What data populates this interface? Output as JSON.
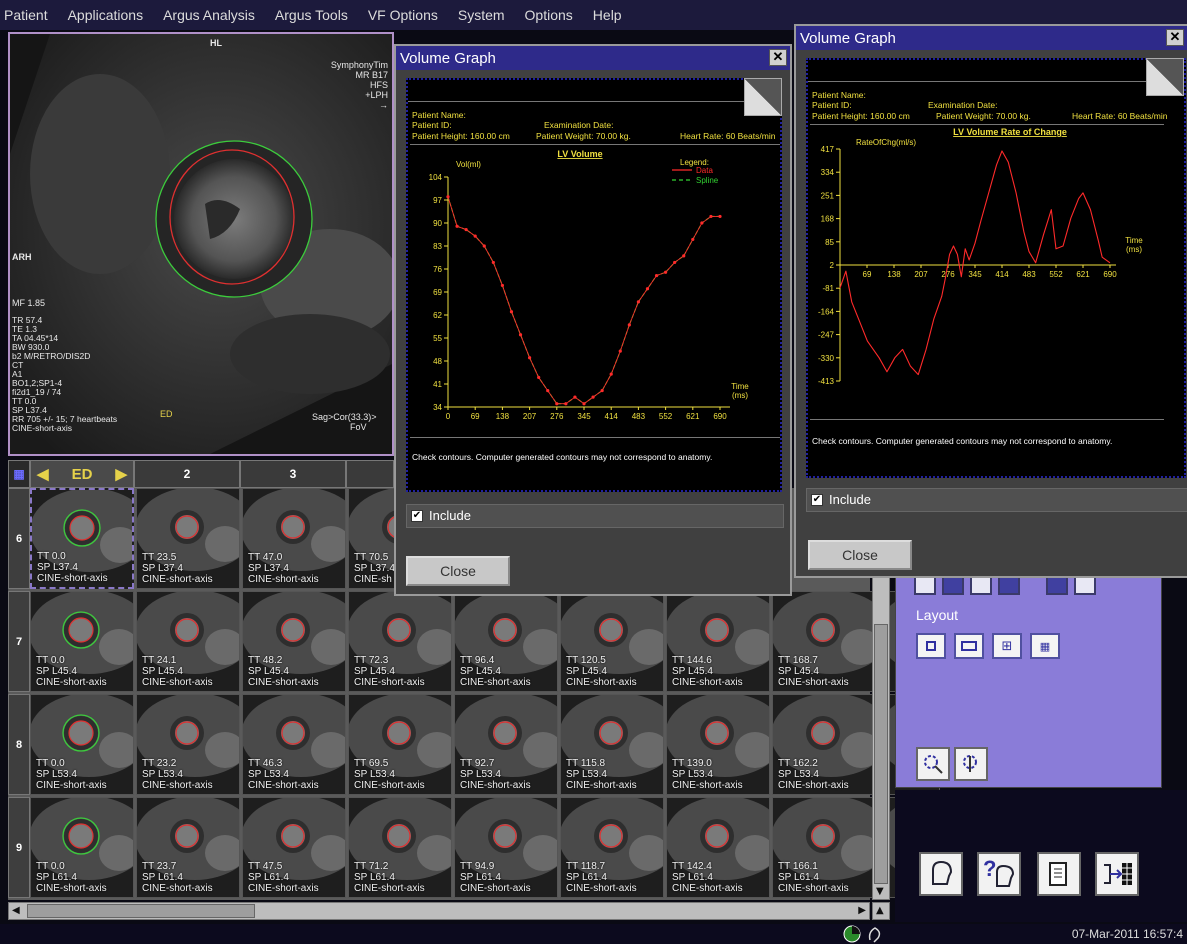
{
  "menu": [
    "Patient",
    "Applications",
    "Argus Analysis",
    "Argus Tools",
    "VF Options",
    "System",
    "Options",
    "Help"
  ],
  "viewport": {
    "top_label": "HL",
    "scanner_lines": "SymphonyTim\nMR B17\nHFS\n+LPH\n→",
    "left_label": "ARH",
    "mf": "MF 1.85",
    "params": "TR 57.4\nTE 1.3\nTA 04.45*14\nBW 930.0\nb2 M/RETRO/DIS2D\nCT\nA1\nBO1,2;SP1-4\nfi2d1_19 / 74\nTT 0.0\nSP L37.4\nRR 705 +/- 15; 7 heartbeats\nCINE-short-axis",
    "ed": "ED",
    "fov": "FoV",
    "sag": "Sag>Cor(33.3)>"
  },
  "strip_header": {
    "phase": "ED",
    "cols": [
      "2",
      "3"
    ]
  },
  "grid": {
    "row_labels": [
      "6",
      "7",
      "8",
      "9"
    ],
    "rows": [
      [
        "TT 0.0\nSP L37.4\nCINE-short-axis",
        "TT 23.5\nSP L37.4\nCINE-short-axis",
        "TT 47.0\nSP L37.4\nCINE-short-axis",
        "TT 70.5\nSP L37.4\nCINE-sh",
        "",
        "",
        "",
        "",
        ""
      ],
      [
        "TT 0.0\nSP L45.4\nCINE-short-axis",
        "TT 24.1\nSP L45.4\nCINE-short-axis",
        "TT 48.2\nSP L45.4\nCINE-short-axis",
        "TT 72.3\nSP L45.4\nCINE-short-axis",
        "TT 96.4\nSP L45.4\nCINE-short-axis",
        "TT 120.5\nSP L45.4\nCINE-short-axis",
        "TT 144.6\nSP L45.4\nCINE-short-axis",
        "TT 168.7\nSP L45.4\nCINE-short-axis",
        ""
      ],
      [
        "TT 0.0\nSP L53.4\nCINE-short-axis",
        "TT 23.2\nSP L53.4\nCINE-short-axis",
        "TT 46.3\nSP L53.4\nCINE-short-axis",
        "TT 69.5\nSP L53.4\nCINE-short-axis",
        "TT 92.7\nSP L53.4\nCINE-short-axis",
        "TT 115.8\nSP L53.4\nCINE-short-axis",
        "TT 139.0\nSP L53.4\nCINE-short-axis",
        "TT 162.2\nSP L53.4\nCINE-short-axis",
        ""
      ],
      [
        "TT 0.0\nSP L61.4\nCINE-short-axis",
        "TT 23.7\nSP L61.4\nCINE-short-axis",
        "TT 47.5\nSP L61.4\nCINE-short-axis",
        "TT 71.2\nSP L61.4\nCINE-short-axis",
        "TT 94.9\nSP L61.4\nCINE-short-axis",
        "TT 118.7\nSP L61.4\nCINE-short-axis",
        "TT 142.4\nSP L61.4\nCINE-short-axis",
        "TT 166.1\nSP L61.4\nCINE-short-axis",
        ""
      ]
    ]
  },
  "dialog1": {
    "title": "Volume Graph",
    "close_x": "✕",
    "patient_name": "Patient Name:",
    "patient_id": "Patient ID:",
    "exam_date": "Examination Date:",
    "height": "Patient Height: 160.00 cm",
    "weight": "Patient Weight: 70.00 kg.",
    "heart_rate": "Heart Rate: 60 Beats/min",
    "footer": "Check contours. Computer generated contours may not correspond to anatomy.",
    "include": "Include",
    "close": "Close"
  },
  "dialog2": {
    "title": "Volume Graph",
    "close_x": "✕",
    "patient_name": "Patient Name:",
    "patient_id": "Patient ID:",
    "exam_date": "Examination Date:",
    "height": "Patient Height: 160.00 cm",
    "weight": "Patient Weight: 70.00 kg.",
    "heart_rate": "Heart Rate: 60 Beats/min",
    "footer": "Check contours. Computer generated contours may not correspond to anatomy.",
    "include": "Include",
    "close": "Close"
  },
  "chart_data": [
    {
      "type": "line",
      "title": "LV Volume",
      "ylabel": "Vol(ml)",
      "xlabel": "Time\n(ms)",
      "legend_title": "Legend:",
      "x_ticks": [
        0,
        69,
        138,
        207,
        276,
        345,
        414,
        483,
        552,
        621,
        690
      ],
      "y_ticks": [
        34,
        41,
        48,
        55,
        62,
        69,
        76,
        83,
        90,
        97,
        104
      ],
      "xlim": [
        0,
        690
      ],
      "ylim": [
        34,
        104
      ],
      "legend": "top-right",
      "series": [
        {
          "name": "Data",
          "color": "#ff2a2a",
          "x": [
            0,
            23,
            46,
            69,
            92,
            115,
            138,
            161,
            184,
            207,
            230,
            253,
            276,
            299,
            322,
            345,
            368,
            391,
            414,
            437,
            460,
            483,
            506,
            529,
            552,
            575,
            598,
            621,
            644,
            667,
            690
          ],
          "y": [
            98,
            89,
            88,
            86,
            83,
            78,
            71,
            63,
            56,
            49,
            43,
            39,
            35,
            35,
            37,
            35,
            37,
            39,
            44,
            51,
            59,
            66,
            70,
            74,
            75,
            78,
            80,
            85,
            90,
            92,
            92
          ]
        },
        {
          "name": "Spline",
          "color": "#32d232",
          "x": [
            0,
            23,
            46,
            69,
            92,
            115,
            138,
            161,
            184,
            207,
            230,
            253,
            276,
            299,
            322,
            345,
            368,
            391,
            414,
            437,
            460,
            483,
            506,
            529,
            552,
            575,
            598,
            621,
            644,
            667,
            690
          ],
          "y": [
            98,
            89,
            88,
            86,
            83,
            78,
            71,
            63,
            56,
            49,
            43,
            39,
            35,
            35,
            37,
            35,
            37,
            39,
            44,
            51,
            59,
            66,
            70,
            74,
            75,
            78,
            80,
            85,
            90,
            92,
            92
          ]
        }
      ]
    },
    {
      "type": "line",
      "title": "LV Volume Rate of Change",
      "ylabel": "RateOfChg(ml/s)",
      "xlabel": "Time\n(ms)",
      "x_ticks": [
        69,
        138,
        207,
        276,
        345,
        414,
        483,
        552,
        621,
        690
      ],
      "y_ticks": [
        417,
        334,
        251,
        168,
        85,
        2,
        -81,
        -164,
        -247,
        -330,
        -413
      ],
      "xlim": [
        0,
        690
      ],
      "ylim": [
        -413,
        417
      ],
      "series": [
        {
          "name": "",
          "color": "#ff2a2a",
          "x": [
            0,
            15,
            30,
            50,
            70,
            100,
            120,
            140,
            160,
            180,
            200,
            220,
            240,
            260,
            270,
            280,
            290,
            300,
            310,
            320,
            330,
            345,
            360,
            380,
            400,
            414,
            430,
            450,
            470,
            483,
            500,
            520,
            540,
            552,
            570,
            590,
            610,
            621,
            640,
            660,
            670,
            690
          ],
          "y": [
            -80,
            -20,
            -130,
            -200,
            -270,
            -330,
            -380,
            -330,
            -300,
            -360,
            -390,
            -300,
            -190,
            -110,
            -40,
            40,
            70,
            40,
            -40,
            60,
            20,
            80,
            160,
            260,
            360,
            410,
            370,
            260,
            120,
            50,
            10,
            110,
            200,
            60,
            70,
            170,
            240,
            260,
            200,
            90,
            30,
            10
          ]
        }
      ]
    }
  ],
  "right_panel": {
    "layout_label": "Layout"
  },
  "status": {
    "datetime": "07-Mar-2011 16:57:4"
  },
  "colors": {
    "menubar": "#1c1a3c",
    "dialog_title": "#2e2a8a",
    "panel": "#8a7cd8",
    "yellow": "#f0e040",
    "red_contour": "#e03030",
    "green_contour": "#3ccc3c"
  }
}
